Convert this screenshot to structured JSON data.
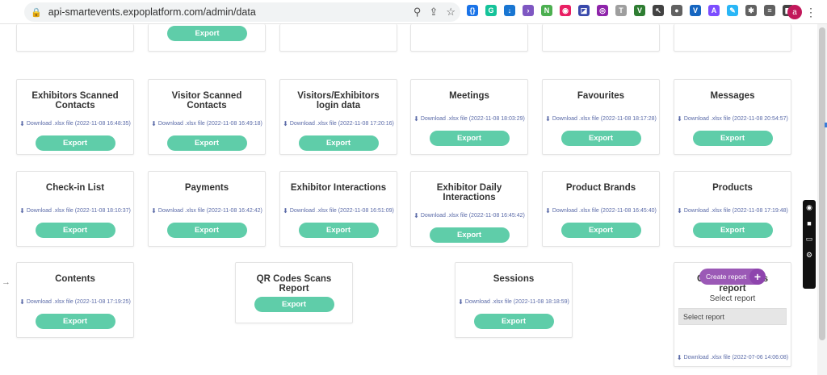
{
  "browser": {
    "url": "api-smartevents.expoplatform.com/admin/data",
    "avatar_letter": "a"
  },
  "extensions": [
    {
      "name": "brackets-extension-icon",
      "color": "#1a73e8",
      "glyph": "{}"
    },
    {
      "name": "grammarly-icon",
      "color": "#15c39a",
      "glyph": "G"
    },
    {
      "name": "download-extension-icon",
      "color": "#1976d2",
      "glyph": "↓"
    },
    {
      "name": "arrow-extension-icon",
      "color": "#7e57c2",
      "glyph": "›"
    },
    {
      "name": "scan-extension-icon",
      "color": "#4caf50",
      "glyph": "N"
    },
    {
      "name": "color-wheel-icon",
      "color": "#e91e63",
      "glyph": "◉"
    },
    {
      "name": "pixel-extension-icon",
      "color": "#3949ab",
      "glyph": "◪"
    },
    {
      "name": "camera-extension-icon",
      "color": "#8e24aa",
      "glyph": "◎"
    },
    {
      "name": "text-extension-icon",
      "color": "#9e9e9e",
      "glyph": "T"
    },
    {
      "name": "vpn-extension-icon",
      "color": "#2e7d32",
      "glyph": "V"
    },
    {
      "name": "cursor-extension-icon",
      "color": "#424242",
      "glyph": "↖"
    },
    {
      "name": "record-extension-icon",
      "color": "#616161",
      "glyph": "●"
    },
    {
      "name": "v-extension-icon",
      "color": "#1565c0",
      "glyph": "V"
    },
    {
      "name": "a-extension-icon",
      "color": "#7c4dff",
      "glyph": "A"
    },
    {
      "name": "feather-extension-icon",
      "color": "#29b6f6",
      "glyph": "✎"
    },
    {
      "name": "puzzle-icon",
      "color": "#616161",
      "glyph": "✱"
    },
    {
      "name": "reading-list-icon",
      "color": "#616161",
      "glyph": "≡"
    },
    {
      "name": "sidepanel-icon",
      "color": "#424242",
      "glyph": "◧"
    }
  ],
  "export_label": "Export",
  "create_report_label": "Create report",
  "select_report_label": "Select report",
  "select_report_placeholder": "Select report",
  "cards": [
    {
      "id": "top-1",
      "title": "",
      "download": "",
      "export": true
    },
    {
      "id": "top-2",
      "title": "",
      "download": "",
      "export": false
    },
    {
      "id": "top-3",
      "title": "",
      "download": "",
      "export": false
    },
    {
      "id": "top-4",
      "title": "",
      "download": "",
      "export": false
    },
    {
      "id": "top-5",
      "title": "",
      "download": "",
      "export": false
    },
    {
      "id": "top-0",
      "title": "",
      "download": "",
      "export": false
    },
    {
      "id": "exhibitors-scanned",
      "title": "Exhibitors Scanned Contacts",
      "download": "Download .xlsx file (2022-11-08 16:48:35)",
      "export": true
    },
    {
      "id": "visitor-scanned",
      "title": "Visitor Scanned Contacts",
      "download": "Download .xlsx file (2022-11-08 16:49:18)",
      "export": true
    },
    {
      "id": "visitors-login",
      "title": "Visitors/Exhibitors login data",
      "download": "Download .xlsx file (2022-11-08 17:20:16)",
      "export": true
    },
    {
      "id": "meetings",
      "title": "Meetings",
      "download": "Download .xlsx file (2022-11-08 18:03:29)",
      "export": true
    },
    {
      "id": "favourites",
      "title": "Favourites",
      "download": "Download .xlsx file (2022-11-08 18:17:28)",
      "export": true
    },
    {
      "id": "messages",
      "title": "Messages",
      "download": "Download .xlsx file (2022-11-08 20:54:57)",
      "export": true
    },
    {
      "id": "checkin-list",
      "title": "Check-in List",
      "download": "Download .xlsx file (2022-11-08 18:10:37)",
      "export": true
    },
    {
      "id": "payments",
      "title": "Payments",
      "download": "Download .xlsx file (2022-11-08 16:42:42)",
      "export": true
    },
    {
      "id": "exhibitor-interactions",
      "title": "Exhibitor Interactions",
      "download": "Download .xlsx file (2022-11-08 16:51:09)",
      "export": true
    },
    {
      "id": "exhibitor-daily",
      "title": "Exhibitor Daily Interactions",
      "download": "Download .xlsx file (2022-11-08 16:45:42)",
      "export": true
    },
    {
      "id": "product-brands",
      "title": "Product Brands",
      "download": "Download .xlsx file (2022-11-08 16:45:40)",
      "export": true
    },
    {
      "id": "products",
      "title": "Products",
      "download": "Download .xlsx file (2022-11-08 17:19:48)",
      "export": true
    },
    {
      "id": "contents",
      "title": "Contents",
      "download": "Download .xlsx file (2022-11-08 17:19:25)",
      "export": true
    },
    {
      "id": "qr-codes",
      "title": "QR Codes Scans Report",
      "download": "",
      "export": true
    },
    {
      "id": "sessions",
      "title": "Sessions",
      "download": "Download .xlsx file (2022-11-08 18:18:59)",
      "export": true
    },
    {
      "id": "custom-visitors",
      "title": "Custom Visitors report",
      "download": "Download .xlsx file (2022-07-06 14:06:08)",
      "export": false
    }
  ]
}
